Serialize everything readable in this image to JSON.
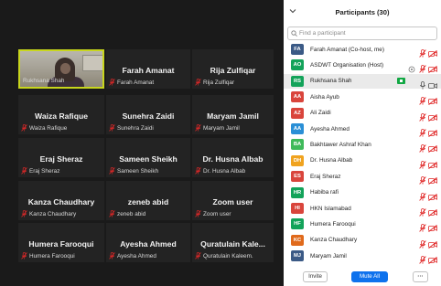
{
  "gallery": {
    "tiles": [
      {
        "title": "",
        "name": "Rukhsana Shah",
        "video": true
      },
      {
        "title": "Farah Amanat",
        "name": "Farah Amanat"
      },
      {
        "title": "Rija Zulfiqar",
        "name": "Rija Zulfiqar"
      },
      {
        "title": "Waiza Rafique",
        "name": "Waiza Rafique"
      },
      {
        "title": "Sunehra Zaidi",
        "name": "Sunehra Zaidi"
      },
      {
        "title": "Maryam Jamil",
        "name": "Maryam Jamil"
      },
      {
        "title": "Eraj Sheraz",
        "name": "Eraj Sheraz"
      },
      {
        "title": "Sameen Sheikh",
        "name": "Sameen Sheikh"
      },
      {
        "title": "Dr. Husna Albab",
        "name": "Dr. Husna Albab"
      },
      {
        "title": "Kanza Chaudhary",
        "name": "Kanza Chaudhary"
      },
      {
        "title": "zeneb abid",
        "name": "zeneb abid"
      },
      {
        "title": "Zoom user",
        "name": "Zoom user"
      },
      {
        "title": "Humera Farooqui",
        "name": "Humera Farooqui"
      },
      {
        "title": "Ayesha Ahmed",
        "name": "Ayesha Ahmed"
      },
      {
        "title": "Quratulain  Kale...",
        "name": "Quratulain Kaleem."
      }
    ]
  },
  "panel": {
    "title": "Participants (30)",
    "search_placeholder": "Find a participant",
    "participants": [
      {
        "initials": "FA",
        "name": "Farah Amanat (Co-host, me)",
        "color": "#3b5a86"
      },
      {
        "initials": "AO",
        "name": "ASDWT Organisation (Host)",
        "color": "#13a35a"
      },
      {
        "initials": "RS",
        "name": "Rukhsana Shah",
        "color": "#13a35a"
      },
      {
        "initials": "AA",
        "name": "Aisha Ayub",
        "color": "#d9453c"
      },
      {
        "initials": "AZ",
        "name": "Ali Zaidi",
        "color": "#d9453c"
      },
      {
        "initials": "AA",
        "name": "Ayesha Ahmed",
        "color": "#2a8fd6"
      },
      {
        "initials": "BA",
        "name": "Bakhtawer Ashraf Khan",
        "color": "#3fba5a"
      },
      {
        "initials": "DH",
        "name": "Dr. Husna Albab",
        "color": "#f0a31f"
      },
      {
        "initials": "ES",
        "name": "Eraj Sheraz",
        "color": "#d9453c"
      },
      {
        "initials": "HR",
        "name": "Habiba rafi",
        "color": "#13a35a"
      },
      {
        "initials": "HI",
        "name": "HKN Islamabad",
        "color": "#d9453c"
      },
      {
        "initials": "HF",
        "name": "Humera Farooqui",
        "color": "#13a35a"
      },
      {
        "initials": "KC",
        "name": "Kanza Chaudhary",
        "color": "#e06a1c"
      },
      {
        "initials": "MJ",
        "name": "Maryam Jamil",
        "color": "#3b5a86"
      }
    ],
    "buttons": {
      "invite": "Invite",
      "mute_all": "Mute All",
      "more": "···"
    }
  },
  "colors": {
    "muted_red": "#e02828",
    "active_border": "#c8d61d",
    "accent": "#0e72ed"
  }
}
